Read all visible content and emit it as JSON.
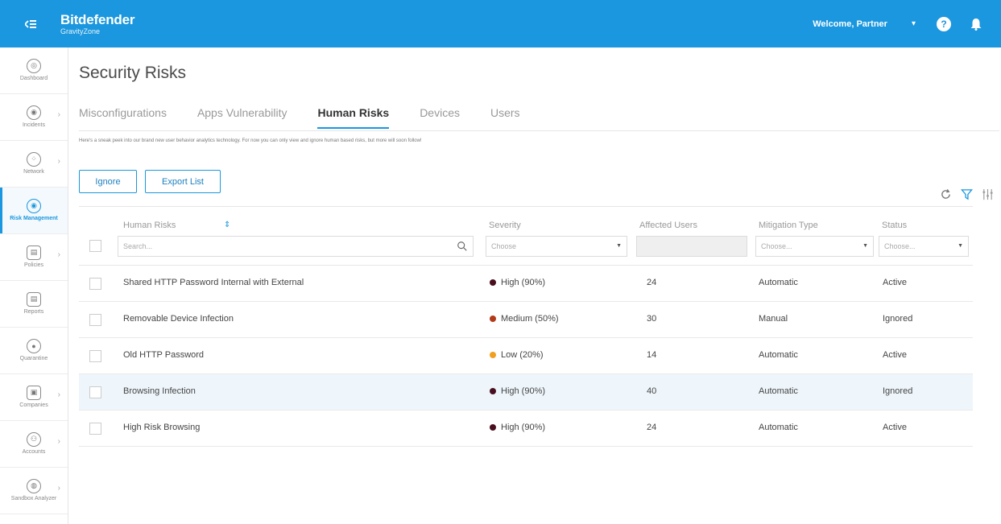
{
  "header": {
    "brand_name": "Bitdefender",
    "brand_sub": "GravityZone",
    "welcome": "Welcome, Partner",
    "help_glyph": "?"
  },
  "sidebar": {
    "items": [
      {
        "label": "Dashboard",
        "icon": "dashboard-icon",
        "glyph": "◎",
        "has_chevron": false
      },
      {
        "label": "Incidents",
        "icon": "incidents-icon",
        "glyph": "◉",
        "has_chevron": true
      },
      {
        "label": "Network",
        "icon": "network-icon",
        "glyph": "⁘",
        "has_chevron": true
      },
      {
        "label": "Risk Management",
        "icon": "risk-management-icon",
        "glyph": "◉",
        "has_chevron": false,
        "active": true
      },
      {
        "label": "Policies",
        "icon": "policies-icon",
        "glyph": "▤",
        "has_chevron": true
      },
      {
        "label": "Reports",
        "icon": "reports-icon",
        "glyph": "▤",
        "has_chevron": false
      },
      {
        "label": "Quarantine",
        "icon": "quarantine-icon",
        "glyph": "●",
        "has_chevron": false
      },
      {
        "label": "Companies",
        "icon": "companies-icon",
        "glyph": "▣",
        "has_chevron": true
      },
      {
        "label": "Accounts",
        "icon": "accounts-icon",
        "glyph": "⚇",
        "has_chevron": true
      },
      {
        "label": "Sandbox Analyzer",
        "icon": "sandbox-icon",
        "glyph": "◍",
        "has_chevron": true
      }
    ]
  },
  "page": {
    "title": "Security Risks",
    "tabs": [
      "Misconfigurations",
      "Apps Vulnerability",
      "Human Risks",
      "Devices",
      "Users"
    ],
    "active_tab": "Human Risks",
    "intro": "Here's a sneak peek into our brand new user behavior analytics technology. For now you can only view and ignore human based risks, but more will soon follow!"
  },
  "toolbar": {
    "ignore_label": "Ignore",
    "export_label": "Export List"
  },
  "table": {
    "columns": {
      "risk": "Human Risks",
      "severity": "Severity",
      "affected": "Affected Users",
      "mitigation": "Mitigation Type",
      "status": "Status"
    },
    "filters": {
      "search_placeholder": "Search...",
      "severity_placeholder": "Choose",
      "mitigation_placeholder": "Choose...",
      "status_placeholder": "Choose..."
    },
    "rows": [
      {
        "risk": "Shared HTTP Password Internal with External",
        "severity": "High (90%)",
        "severity_color": "#4a0f1f",
        "affected": "24",
        "mitigation": "Automatic",
        "status": "Active"
      },
      {
        "risk": "Removable Device Infection",
        "severity": "Medium (50%)",
        "severity_color": "#b23a1a",
        "affected": "30",
        "mitigation": "Manual",
        "status": "Ignored"
      },
      {
        "risk": "Old HTTP Password",
        "severity": "Low (20%)",
        "severity_color": "#f0a020",
        "affected": "14",
        "mitigation": "Automatic",
        "status": "Active"
      },
      {
        "risk": "Browsing Infection",
        "severity": "High (90%)",
        "severity_color": "#4a0f1f",
        "affected": "40",
        "mitigation": "Automatic",
        "status": "Ignored",
        "highlighted": true
      },
      {
        "risk": "High Risk Browsing",
        "severity": "High (90%)",
        "severity_color": "#4a0f1f",
        "affected": "24",
        "mitigation": "Automatic",
        "status": "Active"
      }
    ]
  },
  "colors": {
    "accent": "#1a97de",
    "row_highlight": "#eef6fc"
  }
}
